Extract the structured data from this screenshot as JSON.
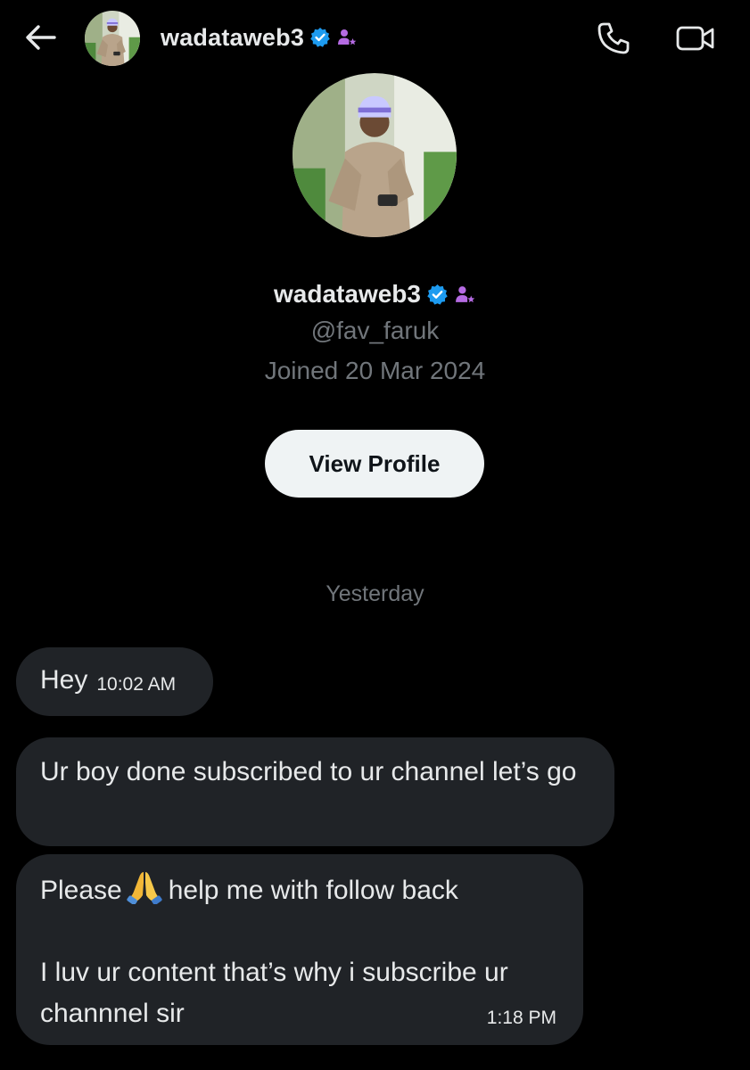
{
  "header": {
    "username": "wadataweb3",
    "back_icon": "arrow-left-icon",
    "call_icon": "phone-icon",
    "video_icon": "video-camera-icon"
  },
  "profile": {
    "name": "wadataweb3",
    "handle": "@fav_faruk",
    "joined": "Joined 20 Mar 2024",
    "view_profile_label": "View Profile",
    "verified_color": "#1d9bf0",
    "subscriber_color": "#b56be3"
  },
  "conversation": {
    "day_separator": "Yesterday",
    "messages": [
      {
        "text": "Hey",
        "time": "10:02 AM"
      },
      {
        "text": "Ur boy done subscribed to ur channel let’s go"
      },
      {
        "line1_before": "Please",
        "emoji": "folded-hands-emoji",
        "line1_after": "help me with follow back",
        "line2": "I luv ur content that’s why i subscribe ur channnel sir",
        "time": "1:18 PM"
      }
    ]
  },
  "theme": {
    "background": "#000000",
    "bubble": "#202327",
    "muted_text": "#71767b",
    "primary_text": "#e7e9ea"
  }
}
